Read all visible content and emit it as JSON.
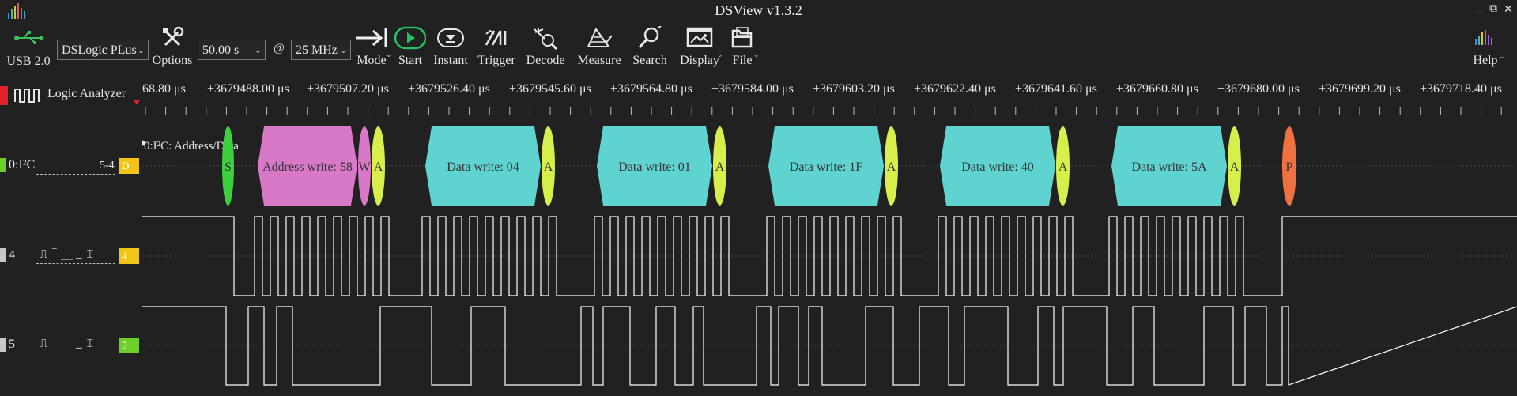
{
  "window": {
    "title": "DSView v1.3.2",
    "controls": [
      "_",
      "⧉",
      "✕"
    ]
  },
  "toolbar": {
    "usb_label": "USB 2.0",
    "device": "DSLogic PLus",
    "options_label": "Options",
    "duration": "50.00 s",
    "at": "@",
    "rate": "25 MHz",
    "mode_label": "Mode",
    "start_label": "Start",
    "instant_label": "Instant",
    "trigger_label": "Trigger",
    "decode_label": "Decode",
    "measure_label": "Measure",
    "search_label": "Search",
    "display_label": "Display",
    "file_label": "File",
    "help_label": "Help"
  },
  "mode": {
    "label": "Logic Analyzer"
  },
  "ruler": {
    "labels": [
      "68.80 μs",
      "+3679488.00 μs",
      "+3679507.20 μs",
      "+3679526.40 μs",
      "+3679545.60 μs",
      "+3679564.80 μs",
      "+3679584.00 μs",
      "+3679603.20 μs",
      "+3679622.40 μs",
      "+3679641.60 μs",
      "+3679660.80 μs",
      "+3679680.00 μs",
      "+3679699.20 μs",
      "+3679718.40 μs"
    ]
  },
  "channels": {
    "decoder": {
      "name": "0:I²C",
      "range": "5-4",
      "tag": "D",
      "annotation_title": "0:I²C: Address/Data",
      "segments": [
        {
          "text": "S",
          "color": "#3ecf3e",
          "kind": "oval"
        },
        {
          "text": "Address write: 58",
          "color": "#d879c8",
          "kind": "box"
        },
        {
          "text": "W",
          "color": "#d879c8",
          "kind": "oval"
        },
        {
          "text": "A",
          "color": "#d8ee4a",
          "kind": "oval"
        },
        {
          "text": "Data write: 04",
          "color": "#5fd3d0",
          "kind": "box"
        },
        {
          "text": "A",
          "color": "#d8ee4a",
          "kind": "oval"
        },
        {
          "text": "Data write: 01",
          "color": "#5fd3d0",
          "kind": "box"
        },
        {
          "text": "A",
          "color": "#d8ee4a",
          "kind": "oval"
        },
        {
          "text": "Data write: 1F",
          "color": "#5fd3d0",
          "kind": "box"
        },
        {
          "text": "A",
          "color": "#d8ee4a",
          "kind": "oval"
        },
        {
          "text": "Data write: 40",
          "color": "#5fd3d0",
          "kind": "box"
        },
        {
          "text": "A",
          "color": "#d8ee4a",
          "kind": "oval"
        },
        {
          "text": "Data write: 5A",
          "color": "#5fd3d0",
          "kind": "box"
        },
        {
          "text": "A",
          "color": "#d8ee4a",
          "kind": "oval"
        },
        {
          "text": "P",
          "color": "#f07040",
          "kind": "oval"
        }
      ]
    },
    "ch4": {
      "name": "4",
      "tag": "4",
      "trigger_icons": "⎍ ‾ ⎽ _ ⌶"
    },
    "ch5": {
      "name": "5",
      "tag": "5",
      "trigger_icons": "⎍ ‾ ⎽ _ ⌶"
    }
  },
  "colors": {
    "background": "#212121",
    "decoder_tag": "#f0c419",
    "ch4_tag": "#f0c419",
    "ch5_tag": "#6fcf2a",
    "mode_mark": "#e0202a",
    "decoder_mark": "#6fcf2a",
    "wave": "#ffffff",
    "start_icon": "#28c060"
  },
  "icons": {
    "usb": "usb-icon",
    "options": "wrench-screwdriver-icon",
    "mode": "arrow-to-line-icon",
    "start": "play-circle-icon",
    "instant": "single-capture-icon",
    "trigger": "trigger-icon",
    "decode": "decode-icon",
    "measure": "measure-icon",
    "search": "search-icon",
    "display": "display-icon",
    "file": "folder-icon",
    "help": "help-bars-icon"
  }
}
